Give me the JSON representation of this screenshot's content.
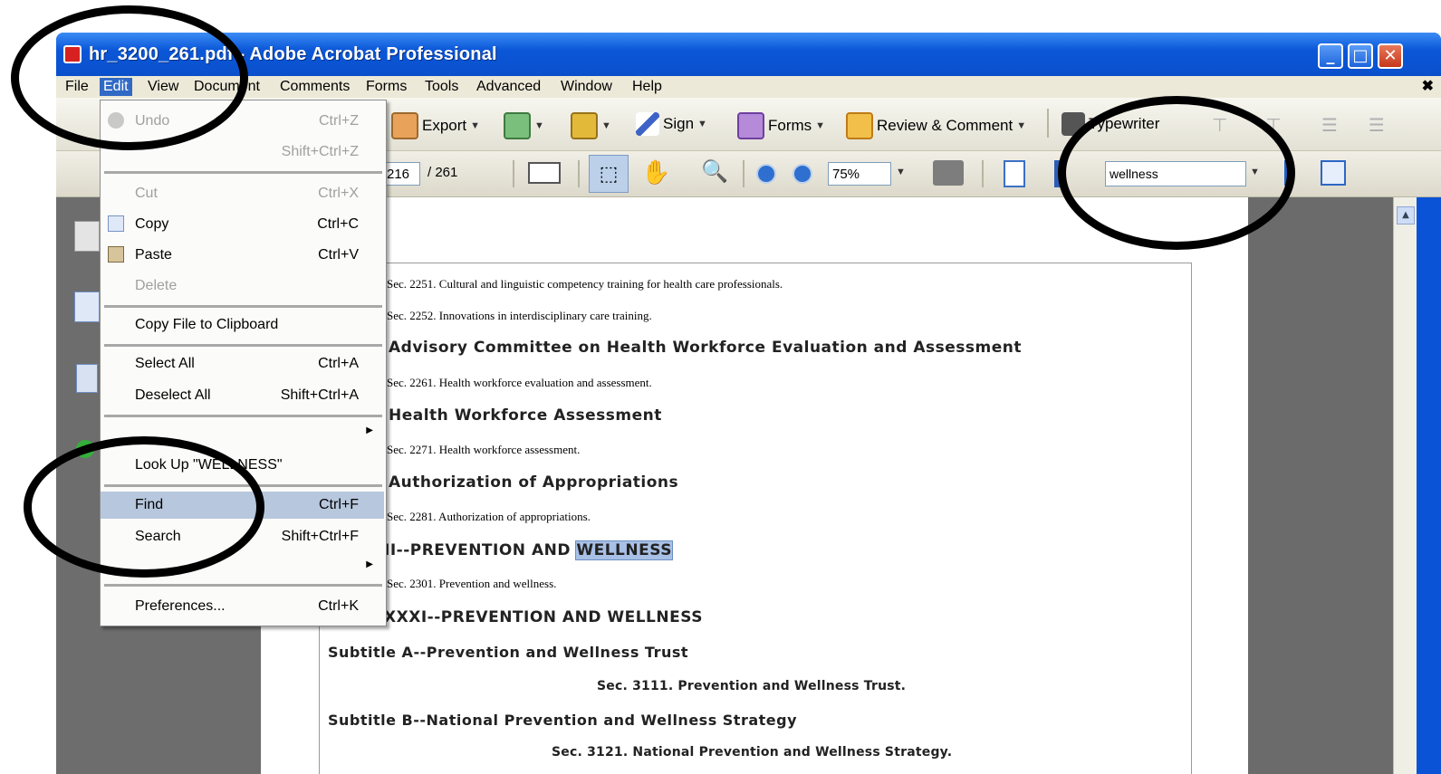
{
  "window": {
    "title": "hr_3200_261.pdf - Adobe Acrobat Professional",
    "controls": [
      "_",
      "□",
      "✕"
    ]
  },
  "menubar": {
    "items": [
      "File",
      "Edit",
      "View",
      "Document",
      "Comments",
      "Forms",
      "Tools",
      "Advanced",
      "Window",
      "Help"
    ],
    "close": "✖"
  },
  "toolbar1": {
    "export": "Export",
    "sign": "Sign",
    "forms": "Forms",
    "review": "Review & Comment",
    "typewriter": "Typewriter"
  },
  "toolbar2": {
    "page_current": "216",
    "page_total": "/ 261",
    "zoom": "75%",
    "search_value": "wellness"
  },
  "edit_menu": {
    "items": [
      {
        "label": "Undo",
        "shortcut": "Ctrl+Z",
        "disabled": true
      },
      {
        "label": "",
        "shortcut": "Shift+Ctrl+Z",
        "disabled": true
      },
      {
        "label": "Cut",
        "shortcut": "Ctrl+X",
        "disabled": true
      },
      {
        "label": "Copy",
        "shortcut": "Ctrl+C",
        "disabled": false
      },
      {
        "label": "Paste",
        "shortcut": "Ctrl+V",
        "disabled": false
      },
      {
        "label": "Delete",
        "shortcut": "",
        "disabled": true
      },
      {
        "label": "Copy File to Clipboard",
        "shortcut": "",
        "disabled": false
      },
      {
        "label": "Select All",
        "shortcut": "Ctrl+A",
        "disabled": false
      },
      {
        "label": "Deselect All",
        "shortcut": "Shift+Ctrl+A",
        "disabled": false
      },
      {
        "label": "Look Up \"WELLNESS\"",
        "shortcut": "",
        "disabled": false
      },
      {
        "label": "Find",
        "shortcut": "Ctrl+F",
        "disabled": false,
        "selected": true
      },
      {
        "label": "Search",
        "shortcut": "Shift+Ctrl+F",
        "disabled": false
      },
      {
        "label": "Preferences...",
        "shortcut": "Ctrl+K",
        "disabled": false
      }
    ]
  },
  "document": {
    "lines": [
      "Sec. 2251. Cultural and linguistic competency training for health care professionals.",
      "Sec. 2252. Innovations in interdisciplinary care training.",
      "Advisory Committee on Health Workforce Evaluation and Assessment",
      "Sec. 2261. Health workforce evaluation and assessment.",
      "Health Workforce Assessment",
      "Sec. 2271. Health workforce assessment.",
      "Authorization of Appropriations",
      "Sec. 2281. Authorization of appropriations.",
      "II--PREVENTION AND ",
      "WELLNESS",
      "Sec. 2301. Prevention and wellness.",
      "XXXI--PREVENTION AND WELLNESS",
      "Subtitle A--Prevention and Wellness Trust",
      "Sec. 3111. Prevention and Wellness Trust.",
      "Subtitle B--National Prevention and Wellness Strategy",
      "Sec. 3121. National Prevention and Wellness Strategy."
    ]
  }
}
